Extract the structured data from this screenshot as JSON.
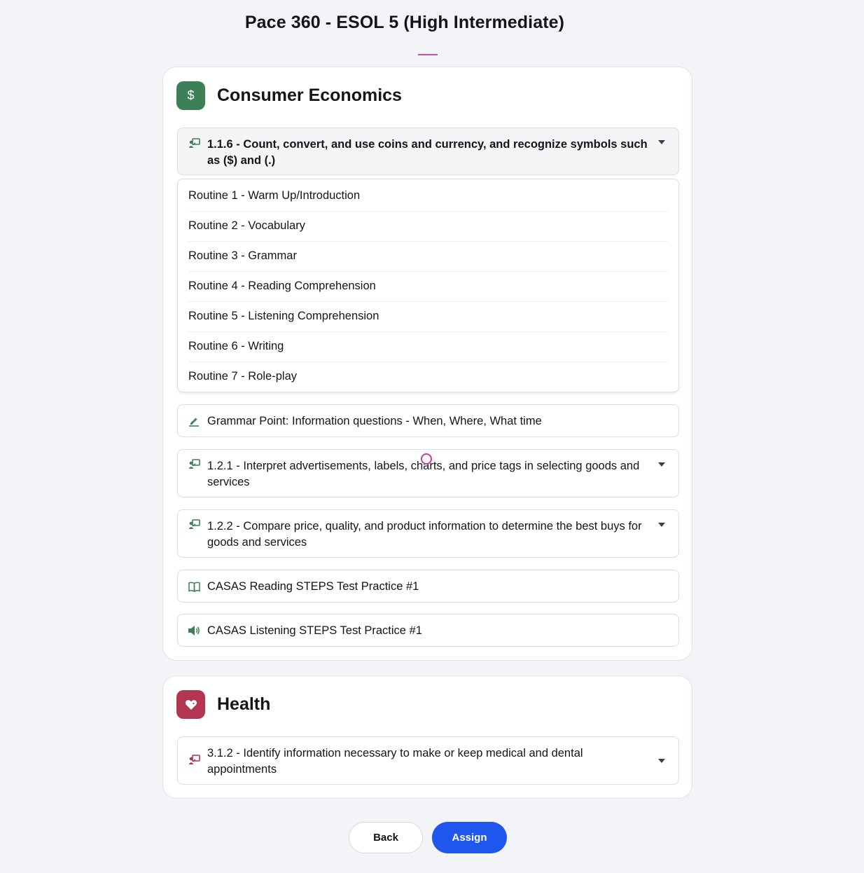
{
  "page": {
    "title": "Pace 360 - ESOL 5 (High Intermediate)"
  },
  "colors": {
    "accent_pink": "#d24ba8",
    "consumer_green": "#3d7f57",
    "health_red": "#b23651",
    "primary_blue": "#1f56ee"
  },
  "consumer": {
    "icon": "dollar-icon",
    "icon_glyph": "$",
    "title": "Consumer Economics",
    "objective_1": {
      "icon": "teacher-board-icon",
      "label": "1.1.6 - Count, convert, and use coins and currency, and recognize symbols such as ($) and (.)",
      "expanded": true
    },
    "routines": [
      "Routine 1 - Warm Up/Introduction",
      "Routine 2 - Vocabulary",
      "Routine 3 - Grammar",
      "Routine 4 - Reading Comprehension",
      "Routine 5 - Listening Comprehension",
      "Routine 6 - Writing",
      "Routine 7 - Role-play"
    ],
    "grammar": {
      "icon": "pencil-icon",
      "label": "Grammar Point: Information questions - When, Where, What time"
    },
    "objective_2": {
      "icon": "teacher-board-icon",
      "label": "1.2.1 - Interpret advertisements, labels, charts, and price tags in selecting goods and services"
    },
    "objective_3": {
      "icon": "teacher-board-icon",
      "label": "1.2.2 - Compare price, quality, and product information to determine the best buys for goods and services"
    },
    "reading_test": {
      "icon": "open-book-icon",
      "label": "CASAS Reading STEPS Test Practice #1"
    },
    "listening_test": {
      "icon": "speaker-icon",
      "label": "CASAS Listening STEPS Test Practice #1"
    }
  },
  "health": {
    "icon": "heart-icon",
    "title": "Health",
    "objective_1": {
      "icon": "teacher-board-icon",
      "label": "3.1.2 - Identify information necessary to make or keep medical and dental appointments"
    }
  },
  "actions": {
    "back_label": "Back",
    "assign_label": "Assign"
  }
}
